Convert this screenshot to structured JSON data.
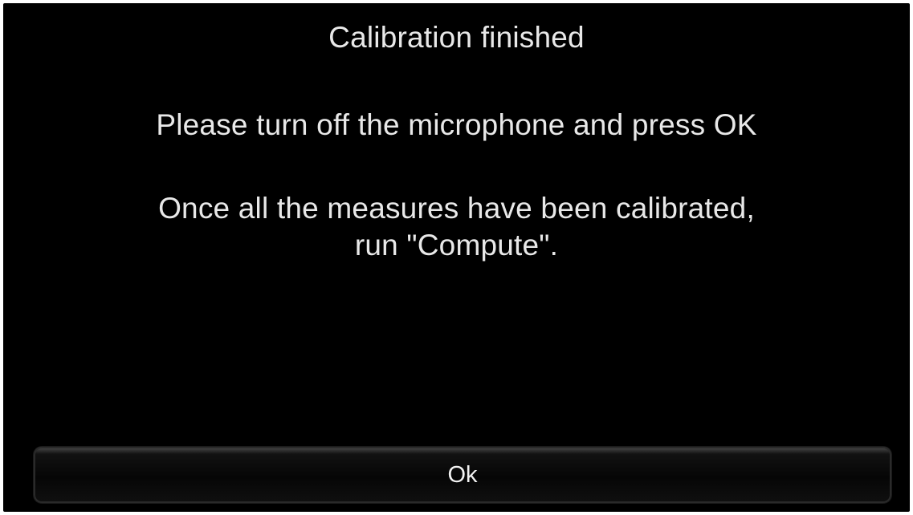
{
  "dialog": {
    "title": "Calibration finished",
    "instruction": "Please turn off the microphone and press OK",
    "note_line1": "Once all the measures have been calibrated,",
    "note_line2": "run \"Compute\".",
    "ok_label": "Ok"
  },
  "colors": {
    "background": "#000000",
    "text": "#e8e8e8"
  }
}
